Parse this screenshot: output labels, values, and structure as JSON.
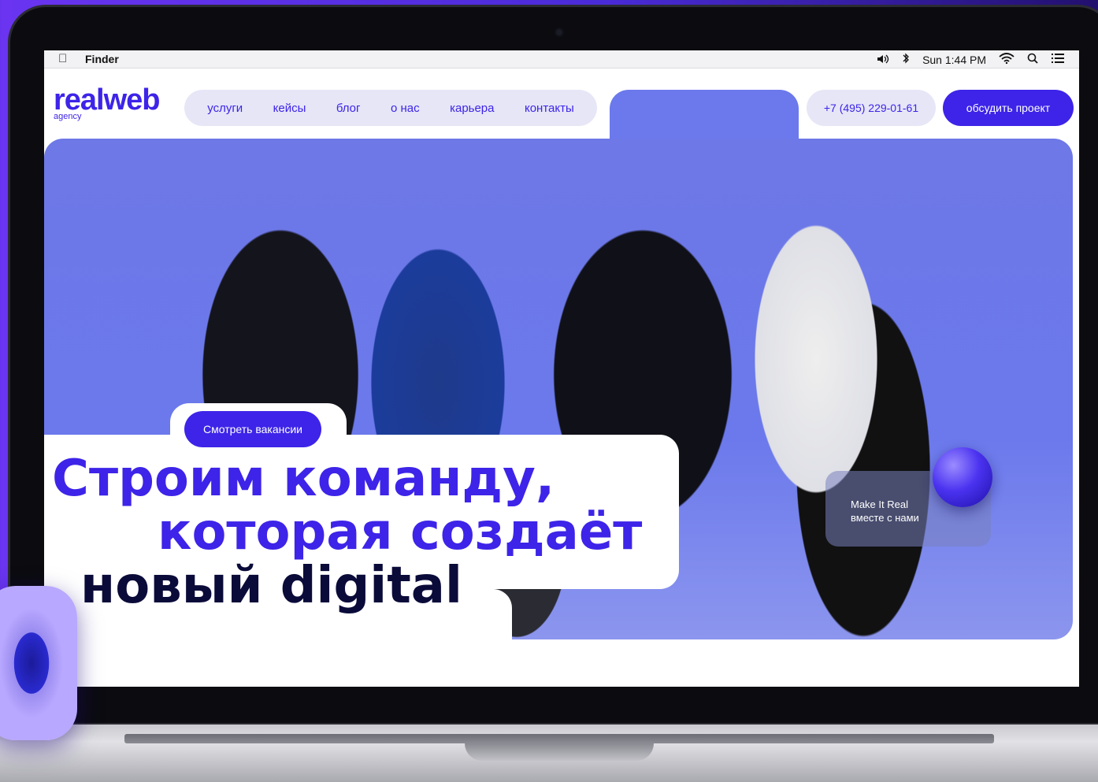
{
  "menubar": {
    "apple_glyph": "",
    "app_name": "Finder",
    "volume_icon": "speaker-icon",
    "bluetooth_icon": "bluetooth-icon",
    "clock": "Sun 1:44 PM",
    "wifi_icon": "wifi-icon",
    "search_icon": "search-icon",
    "menu_icon": "list-icon"
  },
  "header": {
    "logo_text": "realweb",
    "logo_sub": "agency",
    "nav": [
      "услуги",
      "кейсы",
      "блог",
      "о нас",
      "карьера",
      "контакты"
    ],
    "phone": "+7 (495) 229-01-61",
    "cta": "обсудить проект"
  },
  "hero": {
    "vacancies_button": "Смотреть вакансии",
    "headline_line1": "Строим команду,",
    "headline_line2": "которая создаёт",
    "headline_line3": "новый digital",
    "card_line1": "Make It Real",
    "card_line2": "вместе с нами"
  },
  "colors": {
    "brand": "#3d24e8",
    "nav_bg": "#e6e6f7",
    "headline_dark": "#0b0b3a",
    "photo_bg": "#6b79ec"
  }
}
